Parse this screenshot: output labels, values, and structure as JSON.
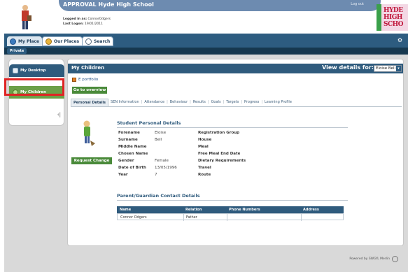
{
  "header": {
    "school_title": "APPROVAL Hyde High School",
    "logout": "Log out",
    "logged_in_label": "Logged in as:",
    "logged_in_value": "ConnorOdgers",
    "last_logon_label": "Last Logon:",
    "last_logon_value": "19/01/2011",
    "school_logo_text": [
      "HYDE",
      "HIGH",
      "SCHO"
    ]
  },
  "tabs": [
    {
      "label": "My Place",
      "icon": "home-icon",
      "active": true
    },
    {
      "label": "Our Places",
      "icon": "globe-icon",
      "active": false
    },
    {
      "label": "Search",
      "icon": "search-icon",
      "active": false
    }
  ],
  "subtab": "Private",
  "sidebar": {
    "items": [
      {
        "label": "My Desktop",
        "icon": "desktop-icon"
      },
      {
        "label": "My Children",
        "icon": "children-icon"
      }
    ],
    "collapse": "‹|"
  },
  "panel": {
    "title": "My Children",
    "view_details_label": "View details for:",
    "selected_student": "Eloise Bell",
    "eportfolio": "E portfolio",
    "goto_overview": "Go to overview",
    "subtabs": [
      "Personal Details",
      "SEN Information",
      "Attendance",
      "Behaviour",
      "Results",
      "Goals",
      "Targets",
      "Progress",
      "Learning Profile"
    ],
    "request_change": "Request Change"
  },
  "student_details": {
    "section_title": "Student Personal Details",
    "rows": [
      {
        "k1": "Forename",
        "v1": "Eloise",
        "k2": "Registration Group"
      },
      {
        "k1": "Surname",
        "v1": "Bell",
        "k2": "House"
      },
      {
        "k1": "Middle Name",
        "v1": "",
        "k2": "Meal"
      },
      {
        "k1": "Chosen Name",
        "v1": "",
        "k2": "Free Meal End Date"
      },
      {
        "k1": "Gender",
        "v1": "Female",
        "k2": "Dietary Requirements"
      },
      {
        "k1": "Date of Birth",
        "v1": "13/05/1996",
        "k2": "Travel"
      },
      {
        "k1": "Year",
        "v1": "7",
        "k2": "Route"
      }
    ]
  },
  "contacts": {
    "section_title": "Parent/Guardian Contact Details",
    "columns": [
      "Name",
      "Relation",
      "Phone Numbers",
      "Address"
    ],
    "rows": [
      {
        "name": "Connor Odgers",
        "relation": "Father",
        "phone": "",
        "address": ""
      }
    ]
  },
  "footer": "Powered by SWGfL Merlin"
}
